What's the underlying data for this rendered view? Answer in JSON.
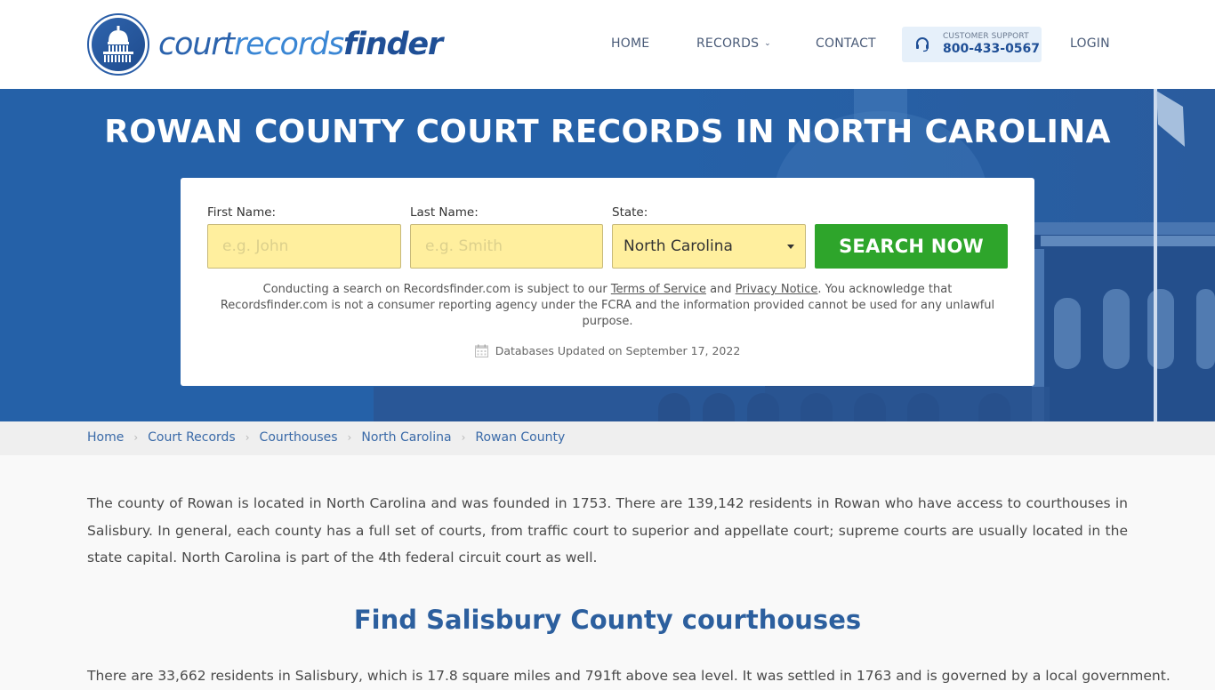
{
  "header": {
    "logo": {
      "part1": "court",
      "part2": "records",
      "part3": "finder",
      "icon": "capitol-dome-icon"
    },
    "nav": {
      "home": "HOME",
      "records": "RECORDS",
      "contact": "CONTACT",
      "login": "LOGIN"
    },
    "support": {
      "label": "CUSTOMER SUPPORT",
      "phone": "800-433-0567",
      "icon": "headset-icon"
    }
  },
  "hero": {
    "title": "ROWAN COUNTY COURT RECORDS IN NORTH CAROLINA",
    "form": {
      "first_name": {
        "label": "First Name:",
        "placeholder": "e.g. John",
        "value": ""
      },
      "last_name": {
        "label": "Last Name:",
        "placeholder": "e.g. Smith",
        "value": ""
      },
      "state": {
        "label": "State:",
        "selected": "North Carolina"
      },
      "search_button": "SEARCH NOW"
    },
    "disclaimer": {
      "before": "Conducting a search on Recordsfinder.com is subject to our ",
      "terms_link": "Terms of Service",
      "and": " and ",
      "privacy_link": "Privacy Notice",
      "after": ". You acknowledge that Recordsfinder.com is not a consumer reporting agency under the FCRA and the information provided cannot be used for any unlawful purpose."
    },
    "db_updated": "Databases Updated on September 17, 2022"
  },
  "breadcrumb": [
    {
      "label": "Home"
    },
    {
      "label": "Court Records"
    },
    {
      "label": "Courthouses"
    },
    {
      "label": "North Carolina"
    },
    {
      "label": "Rowan County"
    }
  ],
  "content": {
    "intro": "The county of Rowan is located in North Carolina and was founded in 1753. There are 139,142 residents in Rowan who have access to courthouses in Salisbury. In general, each county has a full set of courts, from traffic court to superior and appellate court; supreme courts are usually located in the state capital. North Carolina is part of the 4th federal circuit court as well.",
    "section_title": "Find Salisbury County courthouses",
    "section_text": "There are 33,662 residents in Salisbury, which is 17.8 square miles and 791ft above sea level. It was settled in 1763 and is governed by a local government."
  },
  "colors": {
    "brand_blue": "#2561a8",
    "link_blue": "#3a6aa8",
    "heading_blue": "#2c5f9e",
    "search_green": "#2ea52b",
    "input_yellow": "#ffef9e",
    "support_bg": "#e6f0fa"
  }
}
